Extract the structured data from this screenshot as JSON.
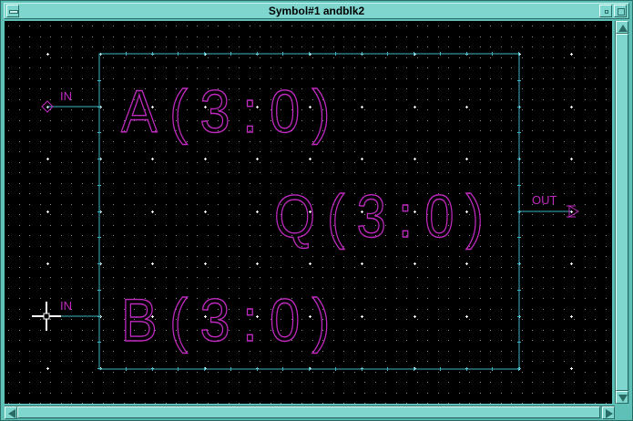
{
  "window": {
    "title": "Symbol#1 andblk2"
  },
  "symbol": {
    "pins": [
      {
        "label": "A(3:0)",
        "direction": "IN"
      },
      {
        "label": "B(3:0)",
        "direction": "IN"
      },
      {
        "label": "Q(3:0)",
        "direction": "OUT"
      }
    ]
  },
  "colors": {
    "background": "#000000",
    "grid_dot": "#ffffff",
    "outline": "#3fb6c6",
    "label": "#c02ac0",
    "frame": "#5fc0b8"
  }
}
